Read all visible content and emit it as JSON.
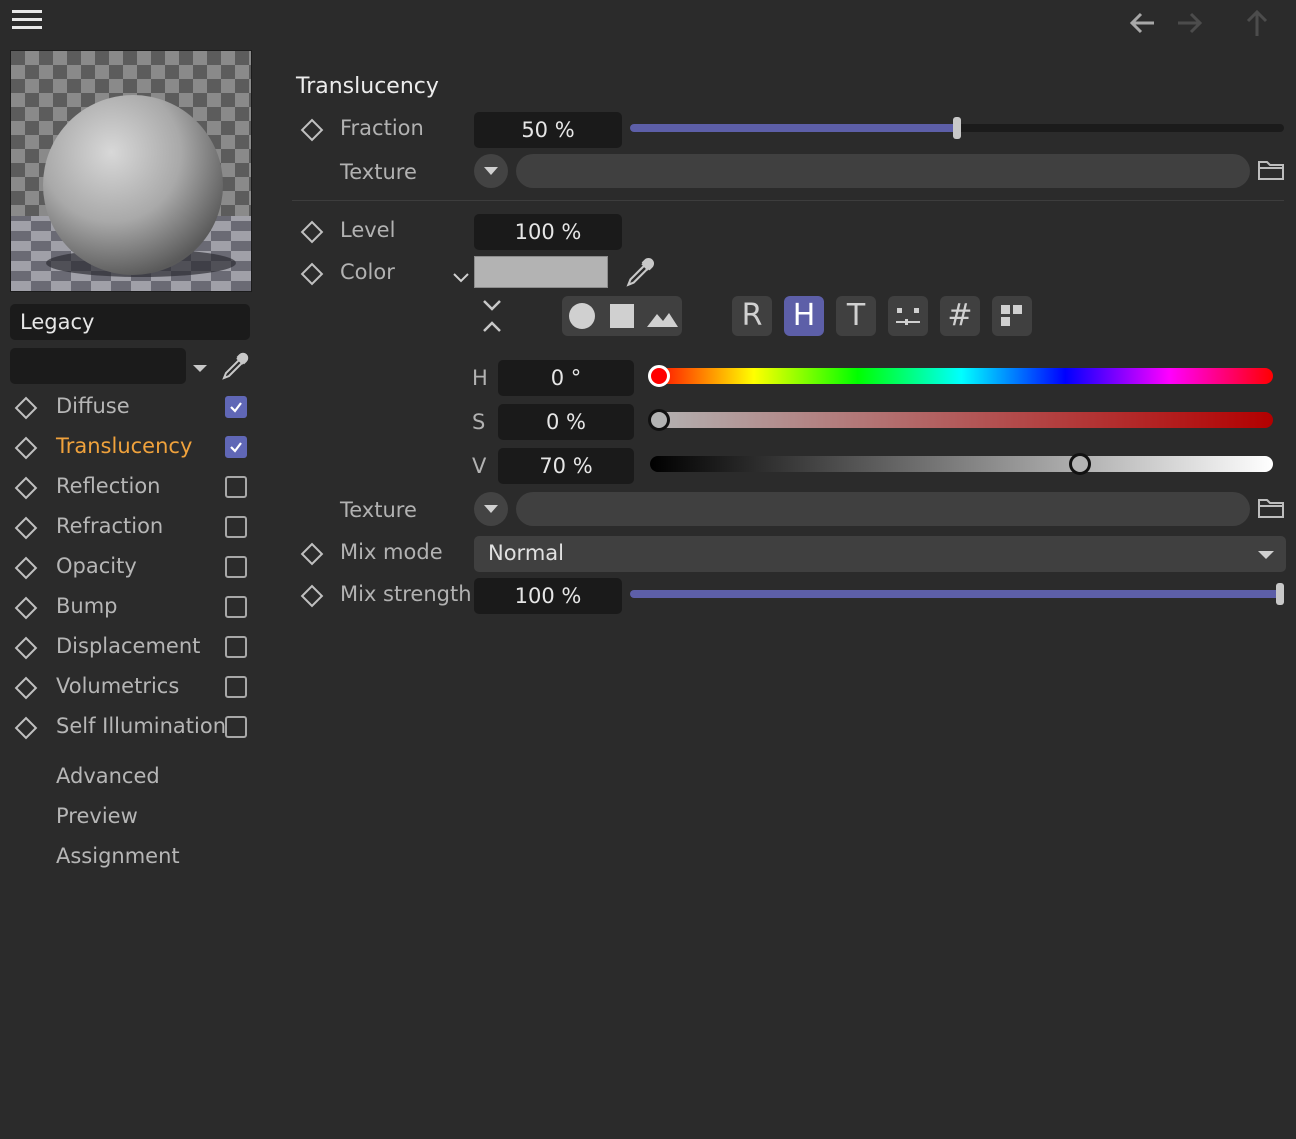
{
  "nav": {
    "menu_icon": "hamburger-icon",
    "back_icon": "arrow-left-icon",
    "forward_icon": "arrow-right-icon",
    "up_icon": "arrow-up-icon"
  },
  "sidebar": {
    "preset": "Legacy",
    "channels": [
      {
        "label": "Diffuse",
        "checked": true,
        "active": false
      },
      {
        "label": "Translucency",
        "checked": true,
        "active": true
      },
      {
        "label": "Reflection",
        "checked": false,
        "active": false
      },
      {
        "label": "Refraction",
        "checked": false,
        "active": false
      },
      {
        "label": "Opacity",
        "checked": false,
        "active": false
      },
      {
        "label": "Bump",
        "checked": false,
        "active": false
      },
      {
        "label": "Displacement",
        "checked": false,
        "active": false
      },
      {
        "label": "Volumetrics",
        "checked": false,
        "active": false
      },
      {
        "label": "Self Illumination",
        "checked": false,
        "active": false
      }
    ],
    "extras": [
      "Advanced",
      "Preview",
      "Assignment"
    ]
  },
  "panel": {
    "title": "Translucency",
    "fraction": {
      "label": "Fraction",
      "value": "50 %",
      "fraction": 0.5
    },
    "texture1": {
      "label": "Texture"
    },
    "level": {
      "label": "Level",
      "value": "100 %"
    },
    "color": {
      "label": "Color",
      "swatch": "#b3b3b3"
    },
    "color_modes": [
      "R",
      "H",
      "T",
      "#"
    ],
    "selected_mode": "H",
    "hsv": {
      "h": {
        "label": "H",
        "value": "0 °",
        "fraction": 0.0
      },
      "s": {
        "label": "S",
        "value": "0 %",
        "fraction": 0.0
      },
      "v": {
        "label": "V",
        "value": "70 %",
        "fraction": 0.7
      }
    },
    "texture2": {
      "label": "Texture"
    },
    "mix_mode": {
      "label": "Mix mode",
      "value": "Normal"
    },
    "mix_strength": {
      "label": "Mix strength",
      "value": "100 %",
      "fraction": 1.0
    }
  },
  "colors": {
    "accent": "#5d5fa8",
    "active_text": "#f0a23c",
    "background": "#2b2b2b"
  }
}
